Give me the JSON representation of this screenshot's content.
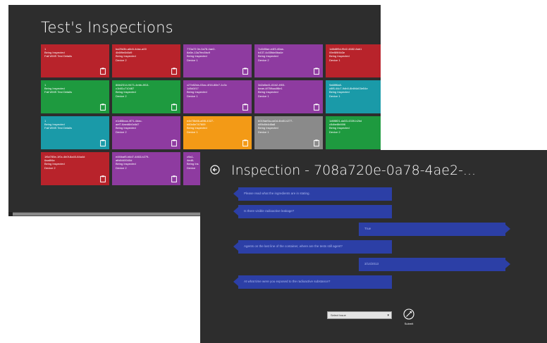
{
  "inspections_screen": {
    "title": "Test's Inspections",
    "colors": {
      "background": "#2d2d2d",
      "red": "#b8232b",
      "purple": "#8e3ba0",
      "green": "#1e9a3f",
      "teal": "#1a9aa8",
      "orange": "#f39a16",
      "gray": "#8a8a8a"
    },
    "tiles": [
      {
        "lines": [
          "1",
          "Being Inspected",
          "Fail WMS Test Details"
        ]
      },
      {
        "lines": [
          "ba29d3b-a8d4-4dac-a00",
          "4b6f9e6b5d9",
          "Being Inspected",
          "Device 2"
        ]
      },
      {
        "lines": [
          "770a72 0e-0a78-4ae2-",
          "8a5e-13a7fec5bc9",
          "Being Inspected",
          "Device 1"
        ]
      },
      {
        "lines": [
          "7c4b5fae-e4f3-40ae-",
          "b437-4c05fde8ba4e",
          "Being Inspected",
          "Device 2"
        ]
      },
      {
        "lines": [
          "1d8d8f5d-f9d2-4682-8ab1",
          "09ef89f4b3e",
          "Being Inspected",
          "Device 1"
        ]
      },
      {
        "lines": [
          "1",
          "Being Inspected",
          "Fail WMS Test Details"
        ]
      },
      {
        "lines": [
          "86fd2314-9471-4ebb-8f13-",
          "c1b81c710487",
          "Being Inspected",
          "Device 2"
        ]
      },
      {
        "lines": [
          "c27e82da-03ac-4f16-88e7-1c3c",
          "1d5d1f17",
          "Being Inspected",
          "Device 1"
        ]
      },
      {
        "lines": [
          "3d2a5a41-61b2-4f03-",
          "beae-4f759aa4f8e1",
          "Being Inspected",
          "Device 1"
        ]
      },
      {
        "lines": [
          "9a68f6a8-",
          "c6f8-44c7-9db0-8b6f4d03e54e",
          "Being Inspected",
          "Device 1"
        ]
      },
      {
        "lines": [
          "1",
          "Being Inspected",
          "Fail WMS Test Details"
        ]
      },
      {
        "lines": [
          "e1d88cca-4f71-4dac-",
          "aef7-6aed6b0c6d7",
          "Being Inspected",
          "Device 2"
        ]
      },
      {
        "lines": [
          "e4e78b66-a8f8-4327-",
          "b60c6e747609",
          "Being Inspected",
          "Device 1"
        ]
      },
      {
        "lines": [
          "b019ae5a-ca0d-4bd0-b277-",
          "d89c6b4d8a8",
          "Being Inspected",
          "Device 1"
        ]
      },
      {
        "lines": [
          "1d6f8f21-da53-4339-b2bd",
          "c5dbe8bf496",
          "Being Inspected",
          "Device 2"
        ]
      },
      {
        "lines": [
          "1f6d785e-1f0c-4b0f-8a40-84a4d",
          "6aa8f4a",
          "Being Inspected",
          "Device 2"
        ]
      },
      {
        "lines": [
          "e4f4baf5-b6d7-4463-b279-",
          "afb8440040d",
          "Being Inspected",
          "Device 2"
        ]
      },
      {
        "lines": [
          "c9a1-",
          "4ed8-",
          "Being Ins",
          "Device"
        ]
      }
    ]
  },
  "inspection_screen": {
    "title": "Inspection - 708a720e-0a78-4ae2-...",
    "messages": [
      {
        "side": "left",
        "text": "Please read what the ingredients are in stating."
      },
      {
        "side": "left",
        "text": "Is there visible radioactive leakage?"
      },
      {
        "side": "right",
        "text": "True"
      },
      {
        "side": "left",
        "text": "Agents on the last line of the container, where are the tests still agent?"
      },
      {
        "side": "right",
        "text": "3/14/2013"
      },
      {
        "side": "left",
        "text": "At what time were you exposed to the radioactive substance?"
      }
    ],
    "select": {
      "value": "Select Issue"
    },
    "submit_label": "Submit"
  }
}
